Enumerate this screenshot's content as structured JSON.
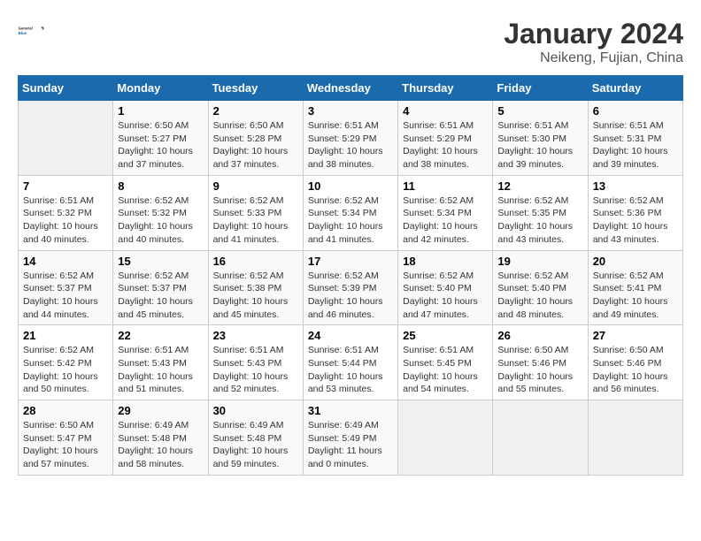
{
  "header": {
    "logo_general": "General",
    "logo_blue": "Blue",
    "month": "January 2024",
    "location": "Neikeng, Fujian, China"
  },
  "calendar": {
    "days_of_week": [
      "Sunday",
      "Monday",
      "Tuesday",
      "Wednesday",
      "Thursday",
      "Friday",
      "Saturday"
    ],
    "weeks": [
      [
        {
          "day": "",
          "content": ""
        },
        {
          "day": "1",
          "content": "Sunrise: 6:50 AM\nSunset: 5:27 PM\nDaylight: 10 hours\nand 37 minutes."
        },
        {
          "day": "2",
          "content": "Sunrise: 6:50 AM\nSunset: 5:28 PM\nDaylight: 10 hours\nand 37 minutes."
        },
        {
          "day": "3",
          "content": "Sunrise: 6:51 AM\nSunset: 5:29 PM\nDaylight: 10 hours\nand 38 minutes."
        },
        {
          "day": "4",
          "content": "Sunrise: 6:51 AM\nSunset: 5:29 PM\nDaylight: 10 hours\nand 38 minutes."
        },
        {
          "day": "5",
          "content": "Sunrise: 6:51 AM\nSunset: 5:30 PM\nDaylight: 10 hours\nand 39 minutes."
        },
        {
          "day": "6",
          "content": "Sunrise: 6:51 AM\nSunset: 5:31 PM\nDaylight: 10 hours\nand 39 minutes."
        }
      ],
      [
        {
          "day": "7",
          "content": "Sunrise: 6:51 AM\nSunset: 5:32 PM\nDaylight: 10 hours\nand 40 minutes."
        },
        {
          "day": "8",
          "content": "Sunrise: 6:52 AM\nSunset: 5:32 PM\nDaylight: 10 hours\nand 40 minutes."
        },
        {
          "day": "9",
          "content": "Sunrise: 6:52 AM\nSunset: 5:33 PM\nDaylight: 10 hours\nand 41 minutes."
        },
        {
          "day": "10",
          "content": "Sunrise: 6:52 AM\nSunset: 5:34 PM\nDaylight: 10 hours\nand 41 minutes."
        },
        {
          "day": "11",
          "content": "Sunrise: 6:52 AM\nSunset: 5:34 PM\nDaylight: 10 hours\nand 42 minutes."
        },
        {
          "day": "12",
          "content": "Sunrise: 6:52 AM\nSunset: 5:35 PM\nDaylight: 10 hours\nand 43 minutes."
        },
        {
          "day": "13",
          "content": "Sunrise: 6:52 AM\nSunset: 5:36 PM\nDaylight: 10 hours\nand 43 minutes."
        }
      ],
      [
        {
          "day": "14",
          "content": "Sunrise: 6:52 AM\nSunset: 5:37 PM\nDaylight: 10 hours\nand 44 minutes."
        },
        {
          "day": "15",
          "content": "Sunrise: 6:52 AM\nSunset: 5:37 PM\nDaylight: 10 hours\nand 45 minutes."
        },
        {
          "day": "16",
          "content": "Sunrise: 6:52 AM\nSunset: 5:38 PM\nDaylight: 10 hours\nand 45 minutes."
        },
        {
          "day": "17",
          "content": "Sunrise: 6:52 AM\nSunset: 5:39 PM\nDaylight: 10 hours\nand 46 minutes."
        },
        {
          "day": "18",
          "content": "Sunrise: 6:52 AM\nSunset: 5:40 PM\nDaylight: 10 hours\nand 47 minutes."
        },
        {
          "day": "19",
          "content": "Sunrise: 6:52 AM\nSunset: 5:40 PM\nDaylight: 10 hours\nand 48 minutes."
        },
        {
          "day": "20",
          "content": "Sunrise: 6:52 AM\nSunset: 5:41 PM\nDaylight: 10 hours\nand 49 minutes."
        }
      ],
      [
        {
          "day": "21",
          "content": "Sunrise: 6:52 AM\nSunset: 5:42 PM\nDaylight: 10 hours\nand 50 minutes."
        },
        {
          "day": "22",
          "content": "Sunrise: 6:51 AM\nSunset: 5:43 PM\nDaylight: 10 hours\nand 51 minutes."
        },
        {
          "day": "23",
          "content": "Sunrise: 6:51 AM\nSunset: 5:43 PM\nDaylight: 10 hours\nand 52 minutes."
        },
        {
          "day": "24",
          "content": "Sunrise: 6:51 AM\nSunset: 5:44 PM\nDaylight: 10 hours\nand 53 minutes."
        },
        {
          "day": "25",
          "content": "Sunrise: 6:51 AM\nSunset: 5:45 PM\nDaylight: 10 hours\nand 54 minutes."
        },
        {
          "day": "26",
          "content": "Sunrise: 6:50 AM\nSunset: 5:46 PM\nDaylight: 10 hours\nand 55 minutes."
        },
        {
          "day": "27",
          "content": "Sunrise: 6:50 AM\nSunset: 5:46 PM\nDaylight: 10 hours\nand 56 minutes."
        }
      ],
      [
        {
          "day": "28",
          "content": "Sunrise: 6:50 AM\nSunset: 5:47 PM\nDaylight: 10 hours\nand 57 minutes."
        },
        {
          "day": "29",
          "content": "Sunrise: 6:49 AM\nSunset: 5:48 PM\nDaylight: 10 hours\nand 58 minutes."
        },
        {
          "day": "30",
          "content": "Sunrise: 6:49 AM\nSunset: 5:48 PM\nDaylight: 10 hours\nand 59 minutes."
        },
        {
          "day": "31",
          "content": "Sunrise: 6:49 AM\nSunset: 5:49 PM\nDaylight: 11 hours\nand 0 minutes."
        },
        {
          "day": "",
          "content": ""
        },
        {
          "day": "",
          "content": ""
        },
        {
          "day": "",
          "content": ""
        }
      ]
    ]
  }
}
